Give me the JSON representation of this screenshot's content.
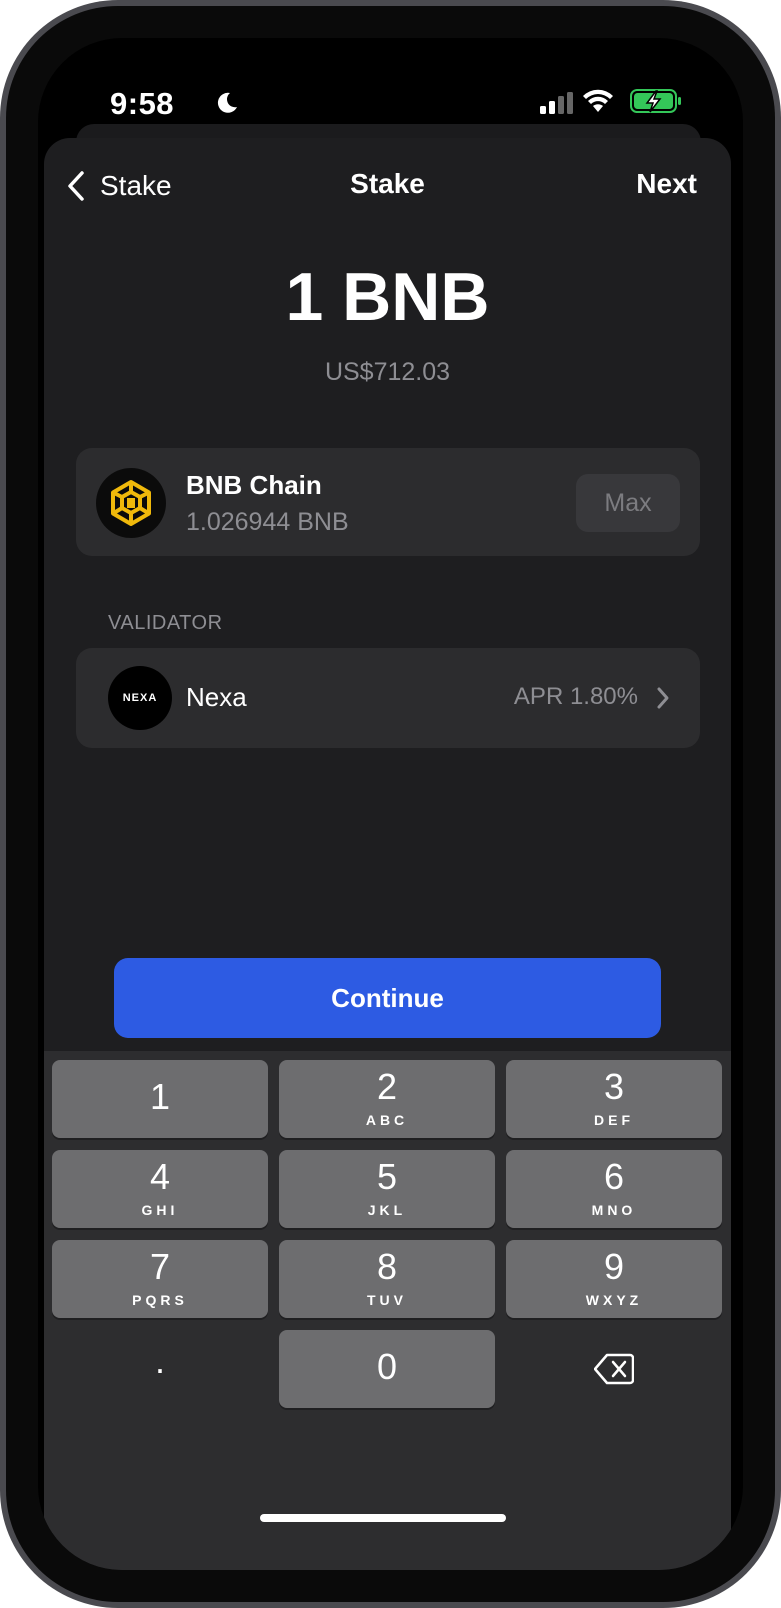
{
  "status_bar": {
    "time": "9:58"
  },
  "nav": {
    "back_label": "Stake",
    "title": "Stake",
    "next_label": "Next"
  },
  "amount": {
    "value": "1 BNB",
    "fiat": "US$712.03"
  },
  "asset": {
    "name": "BNB Chain",
    "balance": "1.026944 BNB",
    "max_label": "Max",
    "logo_color": "#F0B90B"
  },
  "validator": {
    "section_label": "VALIDATOR",
    "logo_text": "NEXA",
    "name": "Nexa",
    "apr": "APR 1.80%"
  },
  "continue_label": "Continue",
  "keypad": {
    "keys": [
      {
        "num": "1",
        "letters": ""
      },
      {
        "num": "2",
        "letters": "ABC"
      },
      {
        "num": "3",
        "letters": "DEF"
      },
      {
        "num": "4",
        "letters": "GHI"
      },
      {
        "num": "5",
        "letters": "JKL"
      },
      {
        "num": "6",
        "letters": "MNO"
      },
      {
        "num": "7",
        "letters": "PQRS"
      },
      {
        "num": "8",
        "letters": "TUV"
      },
      {
        "num": "9",
        "letters": "WXYZ"
      },
      {
        "num": "0",
        "letters": ""
      }
    ],
    "decimal": "."
  },
  "colors": {
    "accent": "#2D5BE3",
    "battery": "#34C759"
  }
}
